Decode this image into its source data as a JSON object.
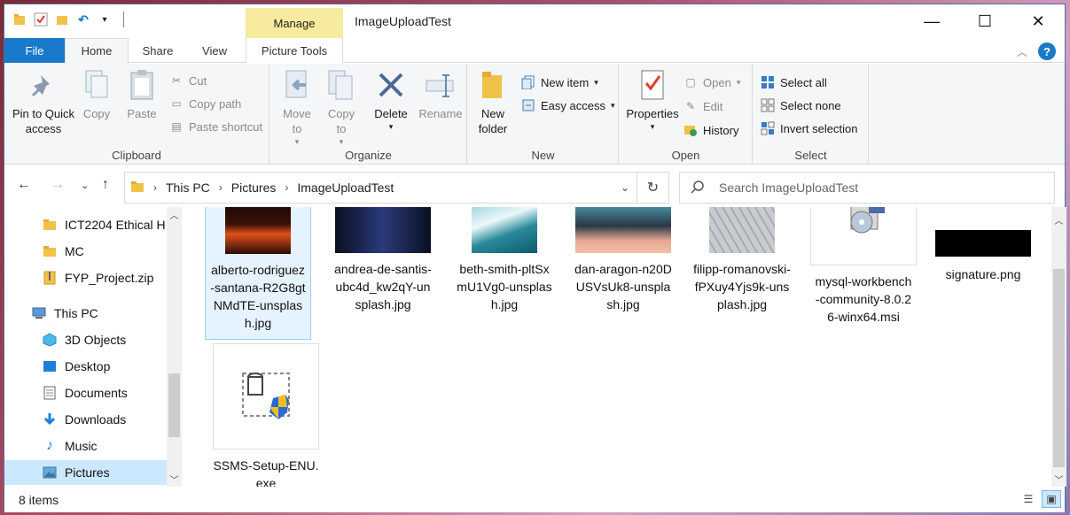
{
  "window": {
    "title": "ImageUploadTest",
    "contextual_tab": "Manage",
    "controls": [
      "—",
      "☐",
      "✕"
    ]
  },
  "tabs": {
    "file": "File",
    "home": "Home",
    "share": "Share",
    "view": "View",
    "picture_tools": "Picture Tools"
  },
  "ribbon": {
    "clipboard": {
      "label": "Clipboard",
      "pin": "Pin to Quick access",
      "copy": "Copy",
      "paste": "Paste",
      "cut": "Cut",
      "copy_path": "Copy path",
      "paste_shortcut": "Paste shortcut"
    },
    "organize": {
      "label": "Organize",
      "move_to": "Move to",
      "copy_to": "Copy to",
      "delete": "Delete",
      "rename": "Rename"
    },
    "new": {
      "label": "New",
      "new_folder": "New folder",
      "new_item": "New item",
      "easy_access": "Easy access"
    },
    "open": {
      "label": "Open",
      "properties": "Properties",
      "open": "Open",
      "edit": "Edit",
      "history": "History"
    },
    "select": {
      "label": "Select",
      "select_all": "Select all",
      "select_none": "Select none",
      "invert": "Invert selection"
    }
  },
  "address": {
    "crumbs": [
      "This PC",
      "Pictures",
      "ImageUploadTest"
    ],
    "search_placeholder": "Search ImageUploadTest"
  },
  "nav": {
    "items": [
      {
        "label": "ICT2204 Ethical H",
        "icon": "folder-icon"
      },
      {
        "label": "MC",
        "icon": "folder-icon"
      },
      {
        "label": "FYP_Project.zip",
        "icon": "zip-icon"
      },
      {
        "label": "This PC",
        "icon": "computer-icon"
      },
      {
        "label": "3D Objects",
        "icon": "cube-icon"
      },
      {
        "label": "Desktop",
        "icon": "desktop-icon"
      },
      {
        "label": "Documents",
        "icon": "documents-icon"
      },
      {
        "label": "Downloads",
        "icon": "download-icon"
      },
      {
        "label": "Music",
        "icon": "music-icon"
      },
      {
        "label": "Pictures",
        "icon": "pictures-icon"
      }
    ]
  },
  "files": [
    {
      "name": "alberto-rodriguez-santana-R2G8gtNMdTE-unsplash.jpg",
      "icon": "volcano-thumbnail"
    },
    {
      "name": "andrea-de-santis-ubc4d_kw2qY-unsplash.jpg",
      "icon": "corridor-thumbnail"
    },
    {
      "name": "beth-smith-pltSxmU1Vg0-unsplash.jpg",
      "icon": "ocean-thumbnail"
    },
    {
      "name": "dan-aragon-n20DUSVsUk8-unsplash.jpg",
      "icon": "clouds-thumbnail"
    },
    {
      "name": "filipp-romanovski-fPXuy4Yjs9k-unsplash.jpg",
      "icon": "building-thumbnail"
    },
    {
      "name": "mysql-workbench-community-8.0.26-winx64.msi",
      "icon": "installer-icon"
    },
    {
      "name": "signature.png",
      "icon": "signature-thumbnail"
    },
    {
      "name": "SSMS-Setup-ENU.exe",
      "icon": "ssms-setup-icon"
    }
  ],
  "status": {
    "count": "8 items"
  }
}
